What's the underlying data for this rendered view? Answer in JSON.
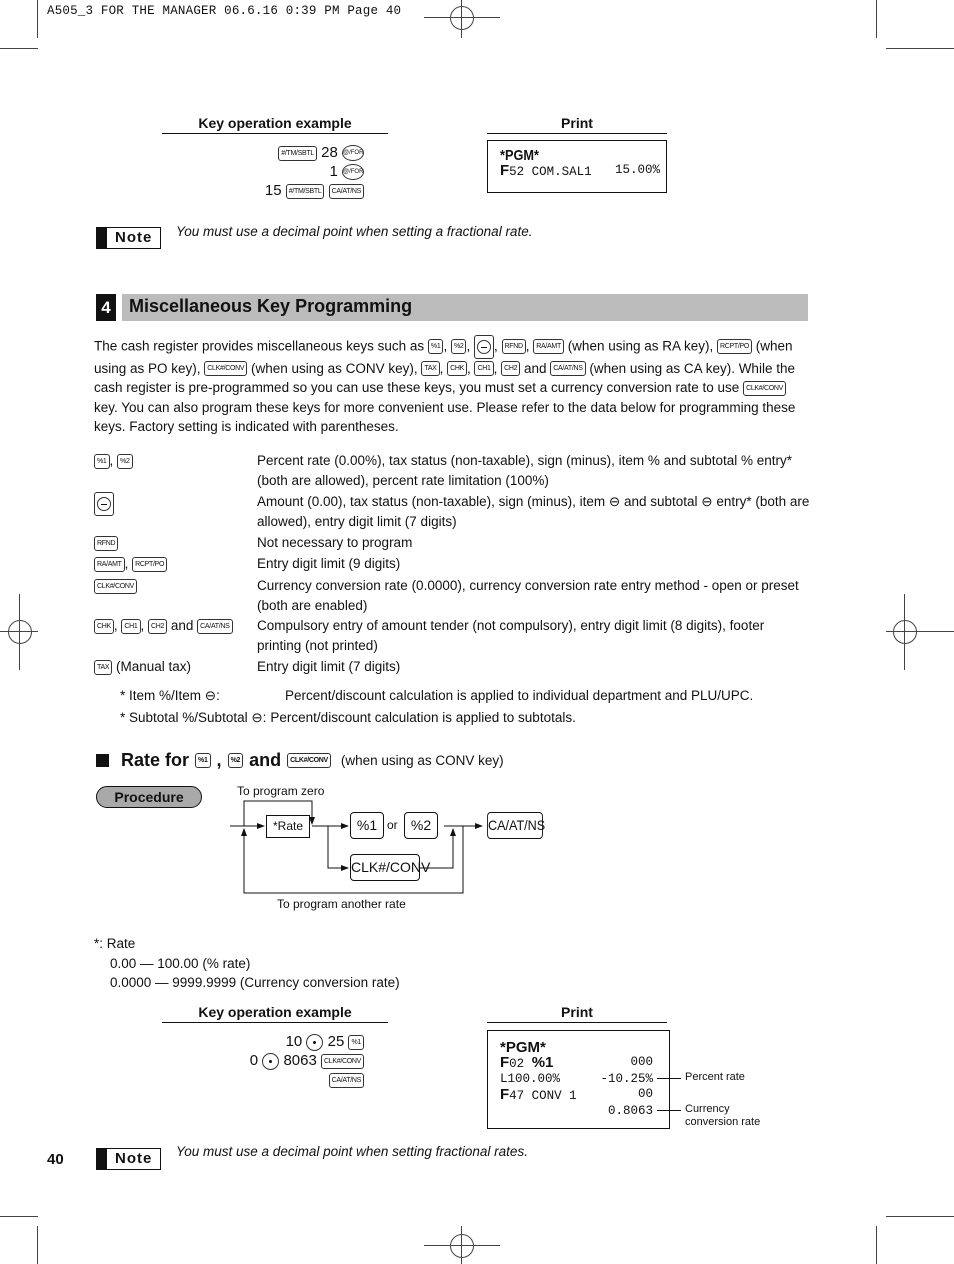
{
  "slug": "A505_3 FOR THE MANAGER  06.6.16 0:39 PM  Page 40",
  "example1": {
    "key_op_heading": "Key operation example",
    "print_heading": "Print",
    "lines": [
      {
        "pre": "",
        "keys": [
          {
            "type": "key",
            "label": "#/TM/SBTL"
          }
        ],
        "mid": "28",
        "post_keys": [
          {
            "type": "round",
            "label": "@/FOR"
          }
        ]
      },
      {
        "pre": "",
        "keys": [],
        "mid": "1",
        "post_keys": [
          {
            "type": "round",
            "label": "@/FOR"
          }
        ]
      },
      {
        "pre": "15",
        "keys": [
          {
            "type": "key",
            "label": "#/TM/SBTL"
          },
          {
            "type": "key",
            "label": "CA/AT/NS"
          }
        ],
        "mid": "",
        "post_keys": []
      }
    ],
    "receipt": {
      "header": "*PGM*",
      "rows": [
        {
          "left_bold": "F",
          "left": "52 COM.SAL1",
          "right": "15.00%"
        }
      ]
    }
  },
  "note1": {
    "badge": "Note",
    "text": "You must use a decimal point when setting a fractional rate."
  },
  "section": {
    "number": "4",
    "title": "Miscellaneous Key Programming"
  },
  "intro": {
    "parts": [
      "The cash register provides miscellaneous keys such as ",
      "%1",
      ", ",
      "%2",
      ", ",
      "(-)",
      ", ",
      "RFND",
      ", ",
      "RA/AMT",
      " (when using as RA key), ",
      "RCPT/PO",
      " (when using as PO key), ",
      "CLK#/CONV",
      " (when using as CONV key), ",
      "TAX",
      ", ",
      "CHK",
      ", ",
      "CH1",
      ", ",
      "CH2",
      " and ",
      "CA/AT/NS",
      " (when using as CA key).  While the cash register is pre-programmed so you can use these keys, you must set a currency conversion rate to use ",
      "CLK#/CONV",
      " key.  You can also program these keys for more convenient use.  Please refer to the data below for programming these keys. Factory setting is indicated with parentheses."
    ],
    "key_indices": [
      1,
      3,
      5,
      7,
      9,
      11,
      13,
      15,
      17,
      19,
      21,
      23,
      25
    ]
  },
  "definitions": [
    {
      "keys": [
        "%1",
        "%2"
      ],
      "joiner": ", ",
      "suffix": "",
      "text": "Percent rate (0.00%), tax status (non-taxable), sign (minus), item % and subtotal % entry* (both are allowed), percent rate limitation (100%)"
    },
    {
      "keys": [
        "(-)"
      ],
      "joiner": "",
      "suffix": "",
      "text": "Amount (0.00), tax status (non-taxable), sign (minus), item ⊖ and subtotal ⊖ entry* (both are allowed), entry digit limit (7 digits)"
    },
    {
      "keys": [
        "RFND"
      ],
      "joiner": "",
      "suffix": "",
      "text": "Not necessary to program"
    },
    {
      "keys": [
        "RA/AMT",
        "RCPT/PO"
      ],
      "joiner": ", ",
      "suffix": "",
      "text": "Entry digit limit (9 digits)"
    },
    {
      "keys": [
        "CLK#/CONV"
      ],
      "joiner": "",
      "suffix": "",
      "text": "Currency conversion rate (0.0000), currency conversion rate entry method - open or preset (both are enabled)"
    },
    {
      "keys": [
        "CHK",
        "CH1",
        "CH2",
        "CA/AT/NS"
      ],
      "joiner": ", ",
      "last_joiner": " and ",
      "suffix": "",
      "text": "Compulsory entry of amount tender (not compulsory), entry digit limit (8 digits), footer printing (not printed)"
    },
    {
      "keys": [
        "TAX"
      ],
      "joiner": "",
      "suffix": " (Manual tax)",
      "text": "Entry digit limit (7 digits)"
    }
  ],
  "footnotes": [
    {
      "label": "* Item %/Item ⊖:",
      "text": "Percent/discount calculation is applied to individual department and PLU/UPC."
    },
    {
      "label": "* Subtotal %/Subtotal ⊖:",
      "text": "Percent/discount calculation is applied to subtotals."
    }
  ],
  "rate_heading": {
    "prefix": "Rate for",
    "key1": "%1",
    "comma": ",",
    "key2": "%2",
    "and": "and",
    "key3": "CLK#/CONV",
    "tail": "(when using as CONV key)"
  },
  "procedure": {
    "pill": "Procedure",
    "to_zero": "To program zero",
    "rate_box": "*Rate",
    "key_pct1": "%1",
    "or": "or",
    "key_pct2": "%2",
    "key_conv": "CLK#/CONV",
    "key_ca": "CA/AT/NS",
    "to_another": "To program another rate"
  },
  "rate_note": {
    "title": "*:  Rate",
    "lines": [
      "0.00 — 100.00 (% rate)",
      "0.0000 — 9999.9999 (Currency conversion rate)"
    ]
  },
  "example2": {
    "key_op_heading": "Key operation example",
    "print_heading": "Print",
    "line1": {
      "a": "10",
      "b": "25",
      "key": "%1"
    },
    "line2": {
      "a": "0",
      "b": "8063",
      "key": "CLK#/CONV"
    },
    "line3": {
      "key": "CA/AT/NS"
    },
    "receipt": {
      "header": "*PGM*",
      "rows": [
        {
          "left_bold": "F",
          "left": "02 ",
          "left_bold2": "%1",
          "right": "000"
        },
        {
          "left_bold": "",
          "left": "L100.00%",
          "right": "-10.25%"
        },
        {
          "left_bold": "F",
          "left": "47 CONV 1",
          "right": "00"
        },
        {
          "left_bold": "",
          "left": "",
          "right": "0.8063"
        }
      ]
    },
    "callouts": [
      "Percent rate",
      "Currency conversion rate"
    ]
  },
  "page_number": "40",
  "note2": {
    "badge": "Note",
    "text": "You must use a decimal point when setting fractional rates."
  }
}
